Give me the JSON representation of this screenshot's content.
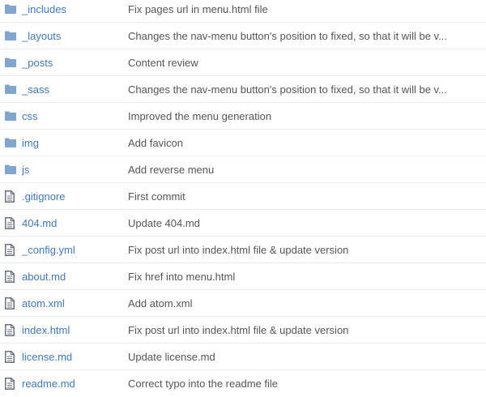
{
  "colors": {
    "accent": "#4078c0",
    "folder_icon": "#80a6cd",
    "file_icon": "#6a737d",
    "message_text": "#555555",
    "row_border": "#eaecef"
  },
  "files": [
    {
      "type": "folder",
      "icon": "folder-icon",
      "name": "_includes",
      "message": "Fix pages url in menu.html file"
    },
    {
      "type": "folder",
      "icon": "folder-icon",
      "name": "_layouts",
      "message": "Changes the nav-menu button's position to fixed, so that it will be v..."
    },
    {
      "type": "folder",
      "icon": "folder-icon",
      "name": "_posts",
      "message": "Content review"
    },
    {
      "type": "folder",
      "icon": "folder-icon",
      "name": "_sass",
      "message": "Changes the nav-menu button's position to fixed, so that it will be v..."
    },
    {
      "type": "folder",
      "icon": "folder-icon",
      "name": "css",
      "message": "Improved the menu generation"
    },
    {
      "type": "folder",
      "icon": "folder-icon",
      "name": "img",
      "message": "Add favicon"
    },
    {
      "type": "folder",
      "icon": "folder-icon",
      "name": "js",
      "message": "Add reverse menu"
    },
    {
      "type": "file",
      "icon": "file-icon",
      "name": ".gitignore",
      "message": "First commit"
    },
    {
      "type": "file",
      "icon": "file-icon",
      "name": "404.md",
      "message": "Update 404.md"
    },
    {
      "type": "file",
      "icon": "file-icon",
      "name": "_config.yml",
      "message": "Fix post url into index.html file & update version"
    },
    {
      "type": "file",
      "icon": "file-icon",
      "name": "about.md",
      "message": "Fix href into menu.html"
    },
    {
      "type": "file",
      "icon": "file-icon",
      "name": "atom.xml",
      "message": "Add atom.xml"
    },
    {
      "type": "file",
      "icon": "file-icon",
      "name": "index.html",
      "message": "Fix post url into index.html file & update version"
    },
    {
      "type": "file",
      "icon": "file-icon",
      "name": "license.md",
      "message": "Update license.md"
    },
    {
      "type": "file",
      "icon": "file-icon",
      "name": "readme.md",
      "message": "Correct typo into the readme file"
    }
  ]
}
